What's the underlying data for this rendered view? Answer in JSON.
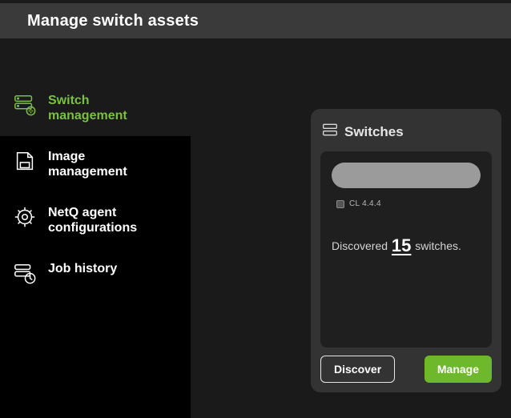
{
  "header": {
    "title": "Manage switch assets"
  },
  "sidebar": {
    "items": [
      {
        "label": "Switch\nmanagement"
      },
      {
        "label": "Image\nmanagement"
      },
      {
        "label": "NetQ agent\nconfigurations"
      },
      {
        "label": "Job history"
      }
    ]
  },
  "card": {
    "title": "Switches",
    "version_label": "CL 4.4.4",
    "discovered_prefix": "Discovered ",
    "discovered_count": "15",
    "discovered_suffix": " switches.",
    "actions": {
      "discover": "Discover",
      "manage": "Manage"
    }
  },
  "colors": {
    "accent": "#7ac142",
    "primary_button": "#6eb82c"
  }
}
